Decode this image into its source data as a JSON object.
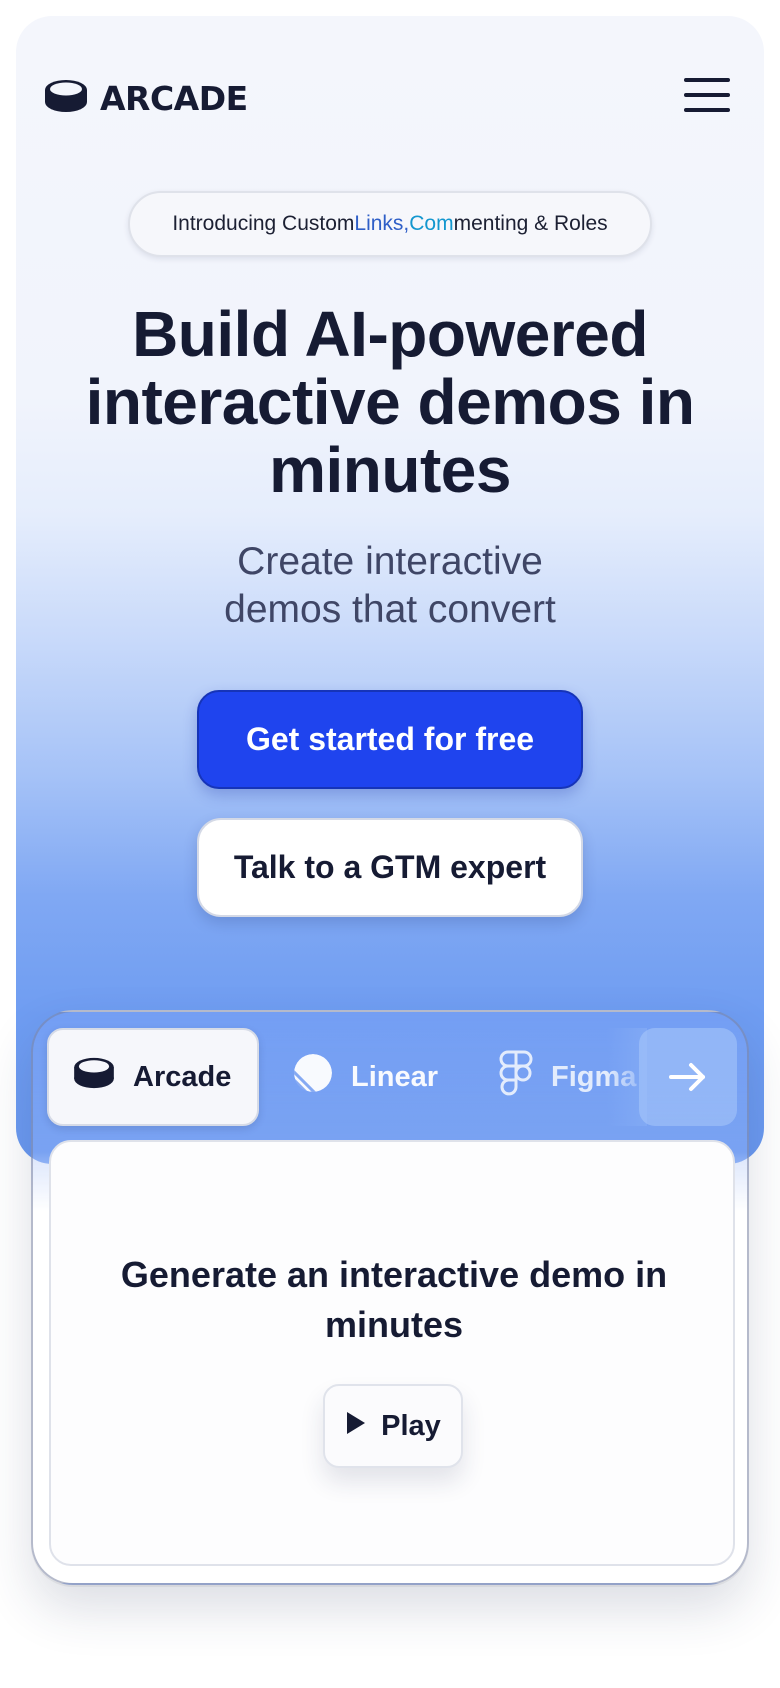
{
  "header": {
    "logo_text": "ARCADE",
    "logo_icon": "arcade-puck-icon",
    "menu_icon": "hamburger-icon"
  },
  "announcement": {
    "part1": "Introducing Custom ",
    "part2": "Links, ",
    "part3": "Com",
    "part4": "menting & Roles"
  },
  "hero": {
    "headline": "Build AI-powered interactive demos in minutes",
    "subhead": "Create interactive demos that convert"
  },
  "cta": {
    "primary": "Get started for free",
    "secondary": "Talk to a GTM expert"
  },
  "demo": {
    "tabs": [
      {
        "label": "Arcade",
        "icon": "arcade-puck-icon",
        "active": true
      },
      {
        "label": "Linear",
        "icon": "linear-logo-icon",
        "active": false
      },
      {
        "label": "Figma",
        "icon": "figma-logo-icon",
        "active": false
      }
    ],
    "next_icon": "arrow-right-icon",
    "title": "Generate an interactive demo in minutes",
    "play_label": "Play",
    "play_icon": "play-icon"
  },
  "colors": {
    "brand_blue": "#1f44ee",
    "text_dark": "#161b33",
    "link_blue": "#2f5fc7",
    "link_cyan": "#1397cf"
  }
}
